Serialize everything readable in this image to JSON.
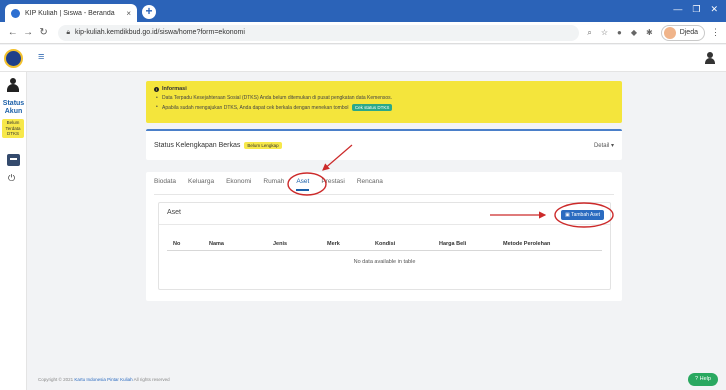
{
  "browser": {
    "tab_title": "KIP Kuliah | Siswa - Beranda",
    "tab_close": "×",
    "new_tab": "+",
    "url": "kip-kuliah.kemdikbud.go.id/siswa/home?form=ekonomi",
    "profile_name": "Djeda"
  },
  "sidebar": {
    "status_label": "Status Akun",
    "status_badge": "Belum Terdata DTKS"
  },
  "info": {
    "title": "Informasi",
    "line1": "Data Terpadu Kesejahteraan Sosial (DTKS) Anda belum ditemukan di pusat pengkatan data Kemensos.",
    "line2": "Apabila sudah mengajukan DTKS, Anda dapat cek berkala dengan menekan tombol",
    "check_button": "Cek status DTKS"
  },
  "berkas": {
    "title": "Status Kelengkapan Berkas",
    "badge": "Belum Lengkap",
    "detail": "Detail ▾"
  },
  "tabs": [
    "Biodata",
    "Keluarga",
    "Ekonomi",
    "Rumah",
    "Aset",
    "Prestasi",
    "Rencana"
  ],
  "active_tab": "Aset",
  "panel": {
    "title": "Aset",
    "add_button": "Tambah Aset",
    "columns": [
      "No",
      "Nama",
      "Jenis",
      "Merk",
      "Kondisi",
      "Harga Beli",
      "Metode Perolehan"
    ],
    "empty_message": "No data available in table"
  },
  "footer": {
    "prefix": "Copyright © 2021",
    "brand": "Kartu Indonesia Pintar Kuliah",
    "suffix": "All rights reserved"
  },
  "help_button": "Help",
  "colors": {
    "chrome_blue": "#2b63b8",
    "info_yellow": "#f4e53c",
    "primary": "#2b6bc0",
    "annotation_red": "#cc2a2a",
    "help_green": "#2aa860"
  }
}
